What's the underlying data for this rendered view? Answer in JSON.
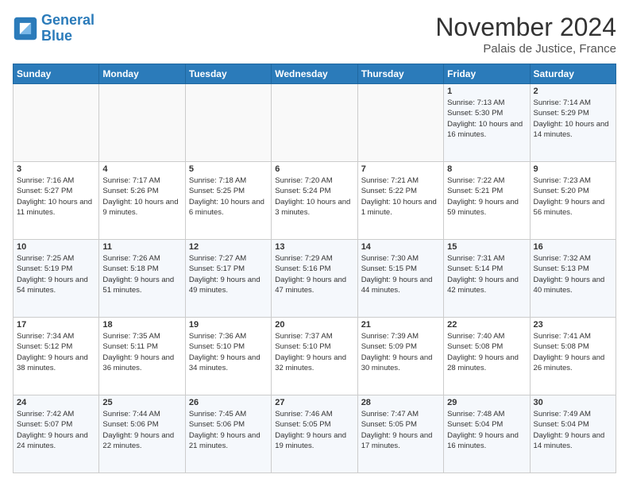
{
  "logo": {
    "line1": "General",
    "line2": "Blue"
  },
  "title": "November 2024",
  "subtitle": "Palais de Justice, France",
  "days_of_week": [
    "Sunday",
    "Monday",
    "Tuesday",
    "Wednesday",
    "Thursday",
    "Friday",
    "Saturday"
  ],
  "weeks": [
    [
      {
        "day": "",
        "info": ""
      },
      {
        "day": "",
        "info": ""
      },
      {
        "day": "",
        "info": ""
      },
      {
        "day": "",
        "info": ""
      },
      {
        "day": "",
        "info": ""
      },
      {
        "day": "1",
        "info": "Sunrise: 7:13 AM\nSunset: 5:30 PM\nDaylight: 10 hours and 16 minutes."
      },
      {
        "day": "2",
        "info": "Sunrise: 7:14 AM\nSunset: 5:29 PM\nDaylight: 10 hours and 14 minutes."
      }
    ],
    [
      {
        "day": "3",
        "info": "Sunrise: 7:16 AM\nSunset: 5:27 PM\nDaylight: 10 hours and 11 minutes."
      },
      {
        "day": "4",
        "info": "Sunrise: 7:17 AM\nSunset: 5:26 PM\nDaylight: 10 hours and 9 minutes."
      },
      {
        "day": "5",
        "info": "Sunrise: 7:18 AM\nSunset: 5:25 PM\nDaylight: 10 hours and 6 minutes."
      },
      {
        "day": "6",
        "info": "Sunrise: 7:20 AM\nSunset: 5:24 PM\nDaylight: 10 hours and 3 minutes."
      },
      {
        "day": "7",
        "info": "Sunrise: 7:21 AM\nSunset: 5:22 PM\nDaylight: 10 hours and 1 minute."
      },
      {
        "day": "8",
        "info": "Sunrise: 7:22 AM\nSunset: 5:21 PM\nDaylight: 9 hours and 59 minutes."
      },
      {
        "day": "9",
        "info": "Sunrise: 7:23 AM\nSunset: 5:20 PM\nDaylight: 9 hours and 56 minutes."
      }
    ],
    [
      {
        "day": "10",
        "info": "Sunrise: 7:25 AM\nSunset: 5:19 PM\nDaylight: 9 hours and 54 minutes."
      },
      {
        "day": "11",
        "info": "Sunrise: 7:26 AM\nSunset: 5:18 PM\nDaylight: 9 hours and 51 minutes."
      },
      {
        "day": "12",
        "info": "Sunrise: 7:27 AM\nSunset: 5:17 PM\nDaylight: 9 hours and 49 minutes."
      },
      {
        "day": "13",
        "info": "Sunrise: 7:29 AM\nSunset: 5:16 PM\nDaylight: 9 hours and 47 minutes."
      },
      {
        "day": "14",
        "info": "Sunrise: 7:30 AM\nSunset: 5:15 PM\nDaylight: 9 hours and 44 minutes."
      },
      {
        "day": "15",
        "info": "Sunrise: 7:31 AM\nSunset: 5:14 PM\nDaylight: 9 hours and 42 minutes."
      },
      {
        "day": "16",
        "info": "Sunrise: 7:32 AM\nSunset: 5:13 PM\nDaylight: 9 hours and 40 minutes."
      }
    ],
    [
      {
        "day": "17",
        "info": "Sunrise: 7:34 AM\nSunset: 5:12 PM\nDaylight: 9 hours and 38 minutes."
      },
      {
        "day": "18",
        "info": "Sunrise: 7:35 AM\nSunset: 5:11 PM\nDaylight: 9 hours and 36 minutes."
      },
      {
        "day": "19",
        "info": "Sunrise: 7:36 AM\nSunset: 5:10 PM\nDaylight: 9 hours and 34 minutes."
      },
      {
        "day": "20",
        "info": "Sunrise: 7:37 AM\nSunset: 5:10 PM\nDaylight: 9 hours and 32 minutes."
      },
      {
        "day": "21",
        "info": "Sunrise: 7:39 AM\nSunset: 5:09 PM\nDaylight: 9 hours and 30 minutes."
      },
      {
        "day": "22",
        "info": "Sunrise: 7:40 AM\nSunset: 5:08 PM\nDaylight: 9 hours and 28 minutes."
      },
      {
        "day": "23",
        "info": "Sunrise: 7:41 AM\nSunset: 5:08 PM\nDaylight: 9 hours and 26 minutes."
      }
    ],
    [
      {
        "day": "24",
        "info": "Sunrise: 7:42 AM\nSunset: 5:07 PM\nDaylight: 9 hours and 24 minutes."
      },
      {
        "day": "25",
        "info": "Sunrise: 7:44 AM\nSunset: 5:06 PM\nDaylight: 9 hours and 22 minutes."
      },
      {
        "day": "26",
        "info": "Sunrise: 7:45 AM\nSunset: 5:06 PM\nDaylight: 9 hours and 21 minutes."
      },
      {
        "day": "27",
        "info": "Sunrise: 7:46 AM\nSunset: 5:05 PM\nDaylight: 9 hours and 19 minutes."
      },
      {
        "day": "28",
        "info": "Sunrise: 7:47 AM\nSunset: 5:05 PM\nDaylight: 9 hours and 17 minutes."
      },
      {
        "day": "29",
        "info": "Sunrise: 7:48 AM\nSunset: 5:04 PM\nDaylight: 9 hours and 16 minutes."
      },
      {
        "day": "30",
        "info": "Sunrise: 7:49 AM\nSunset: 5:04 PM\nDaylight: 9 hours and 14 minutes."
      }
    ]
  ]
}
